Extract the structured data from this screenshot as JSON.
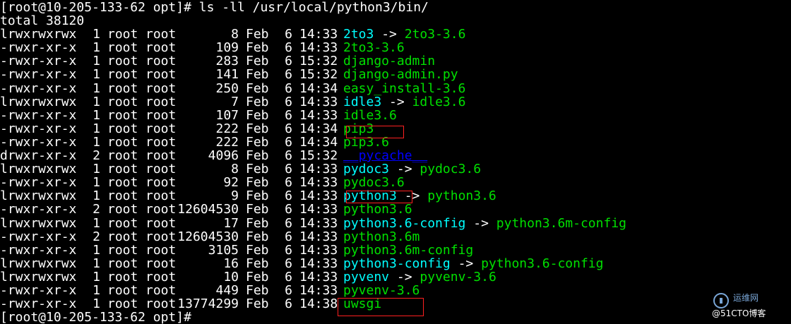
{
  "terminal": {
    "prompt_command": "[root@10-205-133-62 opt]# ls -ll /usr/local/python3/bin/",
    "total": "total 38120",
    "final_prompt": "[root@10-205-133-62 opt]#",
    "colors": {
      "background": "#000000",
      "text": "#ffffff",
      "symlink": "#00ffff",
      "executable": "#00e000",
      "directory": "#0000ff",
      "highlight": "#ff2020"
    },
    "rows": [
      {
        "perm": "lrwxrwxrwx",
        "links": "1",
        "owner": "root",
        "group": "root",
        "size": "8",
        "month": "Feb",
        "day": "6",
        "time": "14:33",
        "name": "2to3",
        "target": "2to3-3.6",
        "kind": "symlink"
      },
      {
        "perm": "-rwxr-xr-x",
        "links": "1",
        "owner": "root",
        "group": "root",
        "size": "109",
        "month": "Feb",
        "day": "6",
        "time": "14:33",
        "name": "2to3-3.6",
        "target": "",
        "kind": "exec"
      },
      {
        "perm": "-rwxr-xr-x",
        "links": "1",
        "owner": "root",
        "group": "root",
        "size": "283",
        "month": "Feb",
        "day": "6",
        "time": "15:32",
        "name": "django-admin",
        "target": "",
        "kind": "exec"
      },
      {
        "perm": "-rwxr-xr-x",
        "links": "1",
        "owner": "root",
        "group": "root",
        "size": "141",
        "month": "Feb",
        "day": "6",
        "time": "15:32",
        "name": "django-admin.py",
        "target": "",
        "kind": "exec"
      },
      {
        "perm": "-rwxr-xr-x",
        "links": "1",
        "owner": "root",
        "group": "root",
        "size": "250",
        "month": "Feb",
        "day": "6",
        "time": "14:34",
        "name": "easy_install-3.6",
        "target": "",
        "kind": "exec"
      },
      {
        "perm": "lrwxrwxrwx",
        "links": "1",
        "owner": "root",
        "group": "root",
        "size": "7",
        "month": "Feb",
        "day": "6",
        "time": "14:33",
        "name": "idle3",
        "target": "idle3.6",
        "kind": "symlink"
      },
      {
        "perm": "-rwxr-xr-x",
        "links": "1",
        "owner": "root",
        "group": "root",
        "size": "107",
        "month": "Feb",
        "day": "6",
        "time": "14:33",
        "name": "idle3.6",
        "target": "",
        "kind": "exec"
      },
      {
        "perm": "-rwxr-xr-x",
        "links": "1",
        "owner": "root",
        "group": "root",
        "size": "222",
        "month": "Feb",
        "day": "6",
        "time": "14:34",
        "name": "pip3",
        "target": "",
        "kind": "exec"
      },
      {
        "perm": "-rwxr-xr-x",
        "links": "1",
        "owner": "root",
        "group": "root",
        "size": "222",
        "month": "Feb",
        "day": "6",
        "time": "14:34",
        "name": "pip3.6",
        "target": "",
        "kind": "exec"
      },
      {
        "perm": "drwxr-xr-x",
        "links": "2",
        "owner": "root",
        "group": "root",
        "size": "4096",
        "month": "Feb",
        "day": "6",
        "time": "15:32",
        "name": "__pycache__",
        "target": "",
        "kind": "dir"
      },
      {
        "perm": "lrwxrwxrwx",
        "links": "1",
        "owner": "root",
        "group": "root",
        "size": "8",
        "month": "Feb",
        "day": "6",
        "time": "14:33",
        "name": "pydoc3",
        "target": "pydoc3.6",
        "kind": "symlink"
      },
      {
        "perm": "-rwxr-xr-x",
        "links": "1",
        "owner": "root",
        "group": "root",
        "size": "92",
        "month": "Feb",
        "day": "6",
        "time": "14:33",
        "name": "pydoc3.6",
        "target": "",
        "kind": "exec"
      },
      {
        "perm": "lrwxrwxrwx",
        "links": "1",
        "owner": "root",
        "group": "root",
        "size": "9",
        "month": "Feb",
        "day": "6",
        "time": "14:33",
        "name": "python3",
        "target": "python3.6",
        "kind": "symlink"
      },
      {
        "perm": "-rwxr-xr-x",
        "links": "2",
        "owner": "root",
        "group": "root",
        "size": "12604530",
        "month": "Feb",
        "day": "6",
        "time": "14:33",
        "name": "python3.6",
        "target": "",
        "kind": "exec"
      },
      {
        "perm": "lrwxrwxrwx",
        "links": "1",
        "owner": "root",
        "group": "root",
        "size": "17",
        "month": "Feb",
        "day": "6",
        "time": "14:33",
        "name": "python3.6-config",
        "target": "python3.6m-config",
        "kind": "symlink"
      },
      {
        "perm": "-rwxr-xr-x",
        "links": "2",
        "owner": "root",
        "group": "root",
        "size": "12604530",
        "month": "Feb",
        "day": "6",
        "time": "14:33",
        "name": "python3.6m",
        "target": "",
        "kind": "exec"
      },
      {
        "perm": "-rwxr-xr-x",
        "links": "1",
        "owner": "root",
        "group": "root",
        "size": "3105",
        "month": "Feb",
        "day": "6",
        "time": "14:33",
        "name": "python3.6m-config",
        "target": "",
        "kind": "exec"
      },
      {
        "perm": "lrwxrwxrwx",
        "links": "1",
        "owner": "root",
        "group": "root",
        "size": "16",
        "month": "Feb",
        "day": "6",
        "time": "14:33",
        "name": "python3-config",
        "target": "python3.6-config",
        "kind": "symlink"
      },
      {
        "perm": "lrwxrwxrwx",
        "links": "1",
        "owner": "root",
        "group": "root",
        "size": "10",
        "month": "Feb",
        "day": "6",
        "time": "14:33",
        "name": "pyvenv",
        "target": "pyvenv-3.6",
        "kind": "symlink"
      },
      {
        "perm": "-rwxr-xr-x",
        "links": "1",
        "owner": "root",
        "group": "root",
        "size": "449",
        "month": "Feb",
        "day": "6",
        "time": "14:33",
        "name": "pyvenv-3.6",
        "target": "",
        "kind": "exec"
      },
      {
        "perm": "-rwxr-xr-x",
        "links": "1",
        "owner": "root",
        "group": "root",
        "size": "13774299",
        "month": "Feb",
        "day": "6",
        "time": "14:38",
        "name": "uwsgi",
        "target": "",
        "kind": "exec"
      }
    ],
    "arrow": "->"
  },
  "watermark": {
    "top_text": "运维网",
    "bottom_text": "@51CTO博客"
  }
}
